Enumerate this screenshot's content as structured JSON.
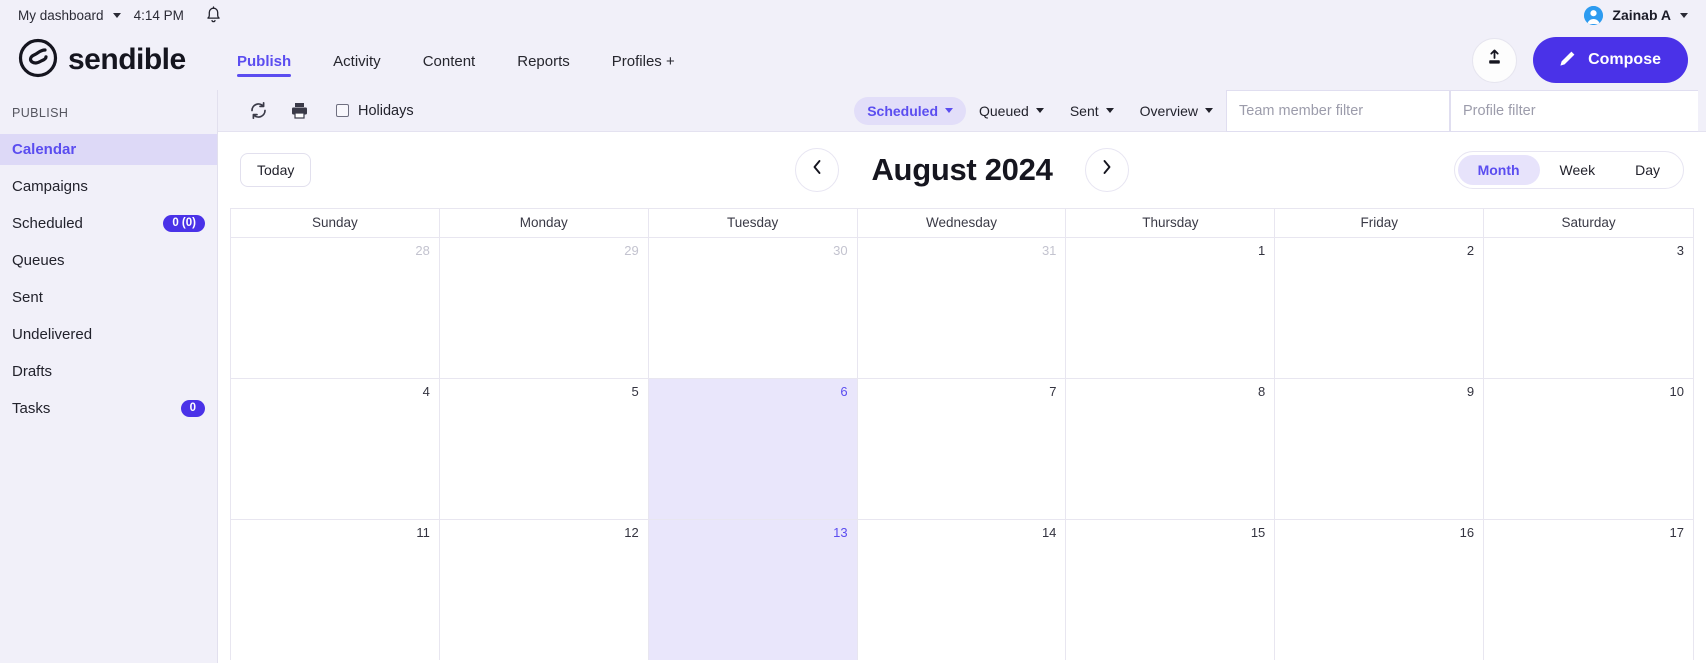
{
  "utility_bar": {
    "dashboard_label": "My dashboard",
    "time": "4:14 PM",
    "bell_icon": "notification-bell-icon",
    "user_name": "Zainab A"
  },
  "header": {
    "brand": "sendible",
    "brand_logo_icon": "sendible-logo-icon",
    "nav": [
      {
        "label": "Publish",
        "active": true
      },
      {
        "label": "Activity",
        "active": false
      },
      {
        "label": "Content",
        "active": false
      },
      {
        "label": "Reports",
        "active": false
      },
      {
        "label": "Profiles +",
        "active": false
      }
    ],
    "upload_icon": "upload-icon",
    "compose_label": "Compose",
    "compose_icon": "pencil-icon"
  },
  "sidebar": {
    "section_title": "PUBLISH",
    "items": [
      {
        "label": "Calendar",
        "badge": null,
        "active": true
      },
      {
        "label": "Campaigns",
        "badge": null,
        "active": false
      },
      {
        "label": "Scheduled",
        "badge": "0 (0)",
        "active": false
      },
      {
        "label": "Queues",
        "badge": null,
        "active": false
      },
      {
        "label": "Sent",
        "badge": null,
        "active": false
      },
      {
        "label": "Undelivered",
        "badge": null,
        "active": false
      },
      {
        "label": "Drafts",
        "badge": null,
        "active": false
      },
      {
        "label": "Tasks",
        "badge": "0",
        "active": false
      }
    ]
  },
  "toolbar": {
    "refresh_icon": "refresh-icon",
    "print_icon": "print-icon",
    "holidays_label": "Holidays",
    "holidays_checked": false,
    "filters": [
      {
        "label": "Scheduled",
        "active": true
      },
      {
        "label": "Queued",
        "active": false
      },
      {
        "label": "Sent",
        "active": false
      },
      {
        "label": "Overview",
        "active": false
      }
    ],
    "team_filter_placeholder": "Team member filter",
    "team_filter_value": "",
    "profile_filter_placeholder": "Profile filter",
    "profile_filter_value": ""
  },
  "calendar": {
    "today_label": "Today",
    "prev_icon": "chevron-left-icon",
    "next_icon": "chevron-right-icon",
    "title": "August 2024",
    "views": [
      {
        "label": "Month",
        "active": true
      },
      {
        "label": "Week",
        "active": false
      },
      {
        "label": "Day",
        "active": false
      }
    ],
    "day_headers": [
      "Sunday",
      "Monday",
      "Tuesday",
      "Wednesday",
      "Thursday",
      "Friday",
      "Saturday"
    ],
    "weeks": [
      [
        {
          "day": "28",
          "other_month": true,
          "today": false
        },
        {
          "day": "29",
          "other_month": true,
          "today": false
        },
        {
          "day": "30",
          "other_month": true,
          "today": false
        },
        {
          "day": "31",
          "other_month": true,
          "today": false
        },
        {
          "day": "1",
          "other_month": false,
          "today": false
        },
        {
          "day": "2",
          "other_month": false,
          "today": false
        },
        {
          "day": "3",
          "other_month": false,
          "today": false
        }
      ],
      [
        {
          "day": "4",
          "other_month": false,
          "today": false
        },
        {
          "day": "5",
          "other_month": false,
          "today": false
        },
        {
          "day": "6",
          "other_month": false,
          "today": true
        },
        {
          "day": "7",
          "other_month": false,
          "today": false
        },
        {
          "day": "8",
          "other_month": false,
          "today": false
        },
        {
          "day": "9",
          "other_month": false,
          "today": false
        },
        {
          "day": "10",
          "other_month": false,
          "today": false
        }
      ],
      [
        {
          "day": "11",
          "other_month": false,
          "today": false
        },
        {
          "day": "12",
          "other_month": false,
          "today": false
        },
        {
          "day": "13",
          "other_month": false,
          "today": false
        },
        {
          "day": "14",
          "other_month": false,
          "today": false
        },
        {
          "day": "15",
          "other_month": false,
          "today": false
        },
        {
          "day": "16",
          "other_month": false,
          "today": false
        },
        {
          "day": "17",
          "other_month": false,
          "today": false
        }
      ]
    ]
  },
  "colors": {
    "accent": "#5b4df0",
    "brand_button": "#4a32e8",
    "chrome_bg": "#f1f0f9",
    "today_cell": "#e9e6fb"
  }
}
